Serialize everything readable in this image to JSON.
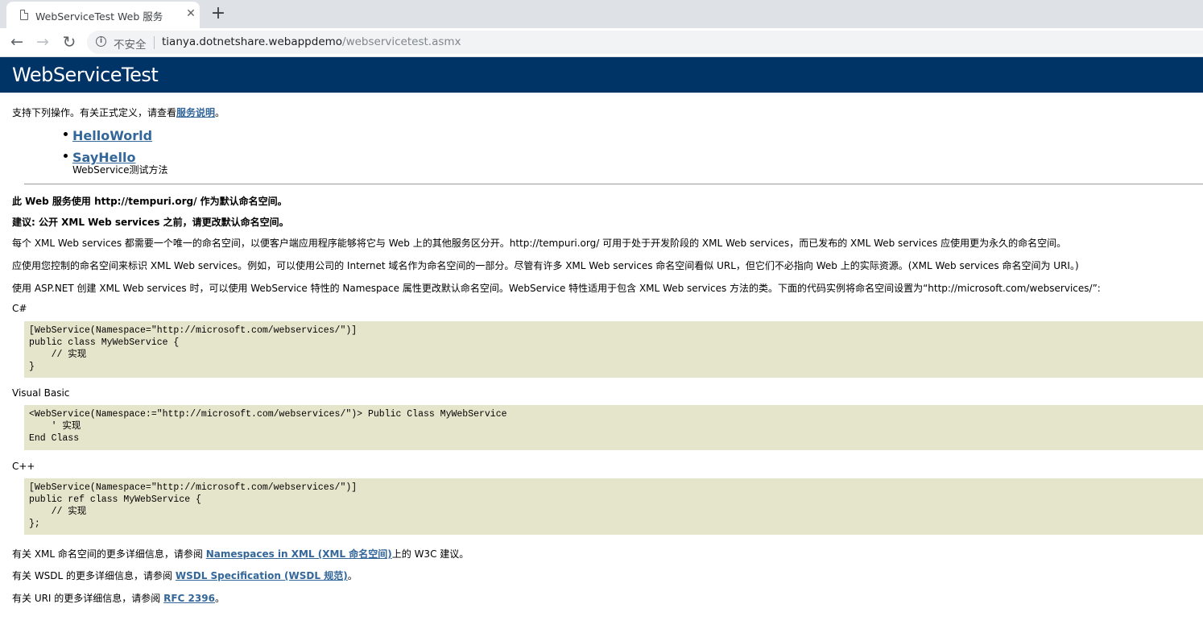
{
  "browser": {
    "tab_title": "WebServiceTest Web 服务",
    "tab_close": "✕",
    "new_tab": "+",
    "back": "←",
    "forward": "→",
    "reload": "↻",
    "insecure_label": "不安全",
    "url_host": "tianya.dotnetshare.webappdemo",
    "url_path": "/webservicetest.asmx"
  },
  "page": {
    "heading": "WebServiceTest",
    "intro_text": "支持下列操作。有关正式定义，请查看",
    "intro_link": "服务说明",
    "intro_end": "。",
    "operations": [
      {
        "name": "HelloWorld",
        "desc": ""
      },
      {
        "name": "SayHello",
        "desc": "WebService测试方法"
      }
    ],
    "ns_line1": "此 Web 服务使用 http://tempuri.org/ 作为默认命名空间。",
    "ns_line2": "建议: 公开 XML Web services 之前，请更改默认命名空间。",
    "para1": "每个 XML Web services 都需要一个唯一的命名空间，以便客户端应用程序能够将它与 Web 上的其他服务区分开。http://tempuri.org/ 可用于处于开发阶段的 XML Web services，而已发布的 XML Web services 应使用更为永久的命名空间。",
    "para2": "应使用您控制的命名空间来标识 XML Web services。例如，可以使用公司的 Internet 域名作为命名空间的一部分。尽管有许多 XML Web services 命名空间看似 URL，但它们不必指向 Web 上的实际资源。(XML Web services 命名空间为 URI。)",
    "para3": "使用 ASP.NET 创建 XML Web services 时，可以使用 WebService 特性的 Namespace 属性更改默认命名空间。WebService 特性适用于包含 XML Web services 方法的类。下面的代码实例将命名空间设置为“http://microsoft.com/webservices/”:",
    "code_samples": [
      {
        "label": "C#",
        "code": "[WebService(Namespace=\"http://microsoft.com/webservices/\")]\npublic class MyWebService {\n    // 实现\n}"
      },
      {
        "label": "Visual Basic",
        "code": "<WebService(Namespace:=\"http://microsoft.com/webservices/\")> Public Class MyWebService\n    ' 实现\nEnd Class"
      },
      {
        "label": "C++",
        "code": "[WebService(Namespace=\"http://microsoft.com/webservices/\")]\npublic ref class MyWebService {\n    // 实现\n};"
      }
    ],
    "footer1_pre": "有关 XML 命名空间的更多详细信息，请参阅 ",
    "footer1_link": "Namespaces in XML (XML 命名空间)",
    "footer1_post": "上的 W3C 建议。",
    "footer2_pre": "有关 WSDL 的更多详细信息，请参阅 ",
    "footer2_link": "WSDL Specification (WSDL 规范)",
    "footer2_post": "。",
    "footer3_pre": "有关 URI 的更多详细信息，请参阅 ",
    "footer3_link": "RFC 2396",
    "footer3_post": "。"
  }
}
